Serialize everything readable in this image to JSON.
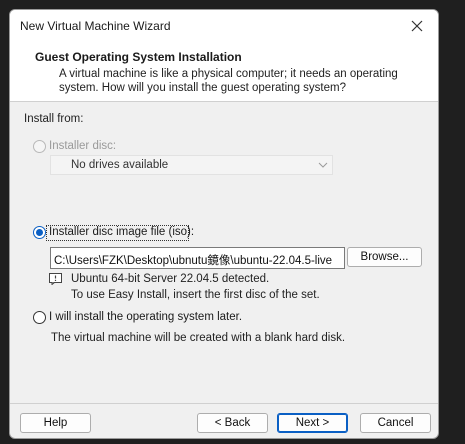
{
  "window": {
    "title": "New Virtual Machine Wizard"
  },
  "header": {
    "title": "Guest Operating System Installation",
    "description": "A virtual machine is like a physical computer; it needs an operating system. How will you install the guest operating system?"
  },
  "install_from": {
    "label": "Install from:",
    "options": {
      "disc": {
        "label": "Installer disc:",
        "selected": false,
        "enabled": false,
        "dropdown_value": "No drives available"
      },
      "iso": {
        "label": "Installer disc image file (iso):",
        "selected": true,
        "enabled": true,
        "path_value": "C:\\Users\\FZK\\Desktop\\ubnutu鏡像\\ubuntu-22.04.5-live",
        "browse_label": "Browse...",
        "detect_line1": "Ubuntu 64-bit Server 22.04.5 detected.",
        "detect_line2": "To use Easy Install, insert the first disc of the set."
      },
      "later": {
        "label": "I will install the operating system later.",
        "selected": false,
        "enabled": true,
        "description": "The virtual machine will be created with a blank hard disk."
      }
    }
  },
  "footer": {
    "help_label": "Help",
    "back_label": "< Back",
    "next_label": "Next >",
    "cancel_label": "Cancel"
  },
  "colors": {
    "accent": "#0a5fc4",
    "window_bg": "#f0f0f0",
    "header_bg": "#ffffff"
  }
}
